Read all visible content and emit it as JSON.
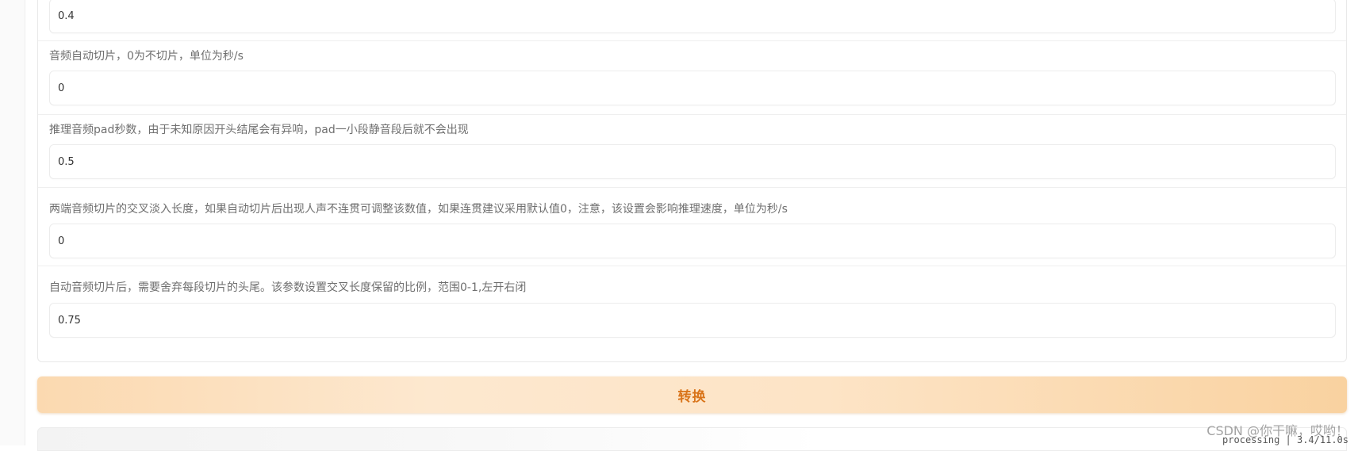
{
  "fields": [
    {
      "label": "",
      "value": "0.4"
    },
    {
      "label": "音频自动切片，0为不切片，单位为秒/s",
      "value": "0"
    },
    {
      "label": "推理音频pad秒数，由于未知原因开头结尾会有异响，pad一小段静音段后就不会出现",
      "value": "0.5"
    },
    {
      "label": "两端音频切片的交叉淡入长度，如果自动切片后出现人声不连贯可调整该数值，如果连贯建议采用默认值0，注意，该设置会影响推理速度，单位为秒/s",
      "value": "0"
    },
    {
      "label": "自动音频切片后，需要舍弃每段切片的头尾。该参数设置交叉长度保留的比例，范围0-1,左开右闭",
      "value": "0.75"
    }
  ],
  "convert_button": {
    "label": "转换"
  },
  "status": {
    "processing_text": "processing | 3.4/11.0s"
  },
  "watermark": {
    "text": "CSDN @你干嘛，哎哟！"
  },
  "colors": {
    "button_text": "#d9741a",
    "button_bg_start": "#fbd9b0",
    "button_bg_end": "#f9d2a0",
    "label_text": "#6f6f6f"
  }
}
